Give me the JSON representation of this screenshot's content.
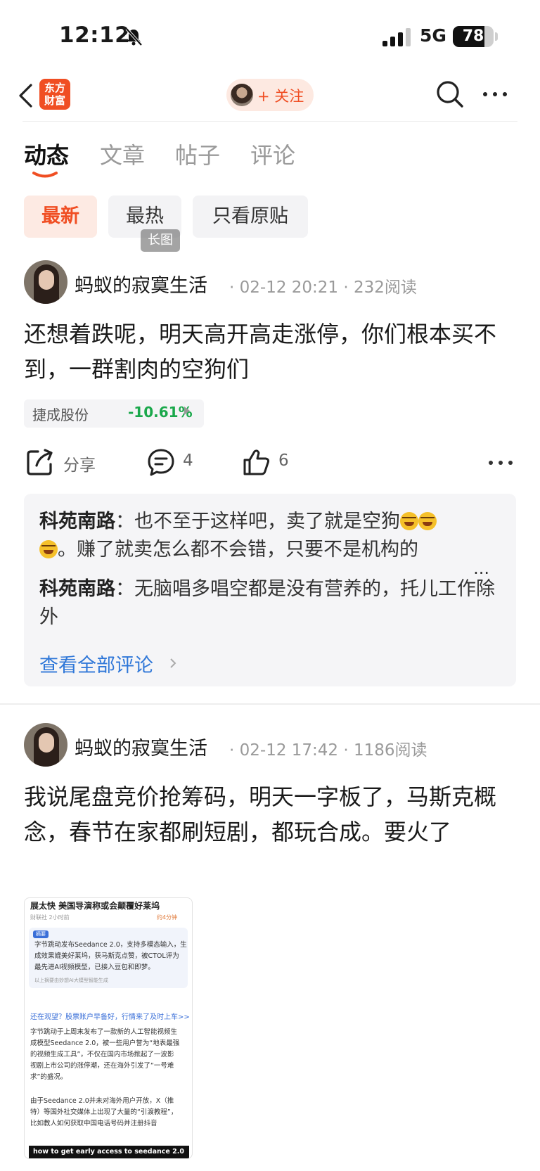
{
  "status_bar": {
    "time": "12:12",
    "network": "5G",
    "battery": "78",
    "battery_level": 0.78
  },
  "nav": {
    "brand_line1": "东方",
    "brand_line2": "财富",
    "follow_label": "+ 关注"
  },
  "tabs": [
    {
      "label": "动态",
      "active": true
    },
    {
      "label": "文章",
      "active": false
    },
    {
      "label": "帖子",
      "active": false
    },
    {
      "label": "评论",
      "active": false
    }
  ],
  "filters": [
    {
      "label": "最新",
      "active": true
    },
    {
      "label": "最热",
      "active": false
    },
    {
      "label": "只看原贴",
      "active": false
    }
  ],
  "posts": [
    {
      "author": "蚂蚁的寂寞生活",
      "meta": "· 02-12 20:21 · 232阅读",
      "body": "还想着跌呢，明天高开高走涨停，你们根本买不到，一群割肉的空狗们",
      "stock": {
        "name": "捷成股份",
        "change": "-10.61%"
      },
      "share_label": "分享",
      "comment_count": "4",
      "like_count": "6",
      "comments": [
        {
          "author": "科苑南路",
          "sep": "：",
          "text_a": "也不至于这样吧，卖了就是空狗",
          "text_b": "。赚了就卖怎么都不会错，只要不是机构的",
          "more": "..."
        },
        {
          "author": "科苑南路",
          "sep": "：",
          "text": "无脑唱多唱空都是没有营养的，托儿工作除外"
        }
      ],
      "view_all": "查看全部评论"
    },
    {
      "author": "蚂蚁的寂寞生活",
      "meta": "· 02-12 17:42 · 1186阅读",
      "body": "我说尾盘竞价抢筹码，明天一字板了，马斯克概念，春节在家都刷短剧，都玩合成。要火了",
      "image": {
        "headline": "展太快 美国导演称或会颠覆好莱坞",
        "meta": "财联社 2小时前",
        "play": "约4分钟",
        "badge": "摘要",
        "summary": [
          "字节跳动发布Seedance 2.0，支持多模态输入，生",
          "成效果媲美好莱坞，获马斯克点赞，被CTOL评为",
          "最先进AI视频模型，已接入豆包和即梦。",
          "以上摘要由妙想AI大模型智能生成"
        ],
        "link": "还在观望？股票账户早备好，行情来了及时上车>>",
        "paragraph1": [
          "字节跳动于上周末发布了一款新的人工智能视频生",
          "成模型Seedance 2.0，被一些用户誉为“地表最强",
          "的视频生成工具”，不仅在国内市场掀起了一波影",
          "视剧上市公司的涨停潮，还在海外引发了“一号难",
          "求”的盛况。"
        ],
        "paragraph2": [
          "由于Seedance 2.0并未对海外用户开放，X（推",
          "特）等国外社交媒体上出现了大量的“引渡教程”，",
          "比如教人如何获取中国电话号码并注册抖音"
        ],
        "footer": "how to get early access to seedance 2.0",
        "long_badge": "长图"
      }
    }
  ],
  "colors": {
    "accent": "#f04e23",
    "down": "#1aa84b",
    "link": "#2f77d8"
  }
}
